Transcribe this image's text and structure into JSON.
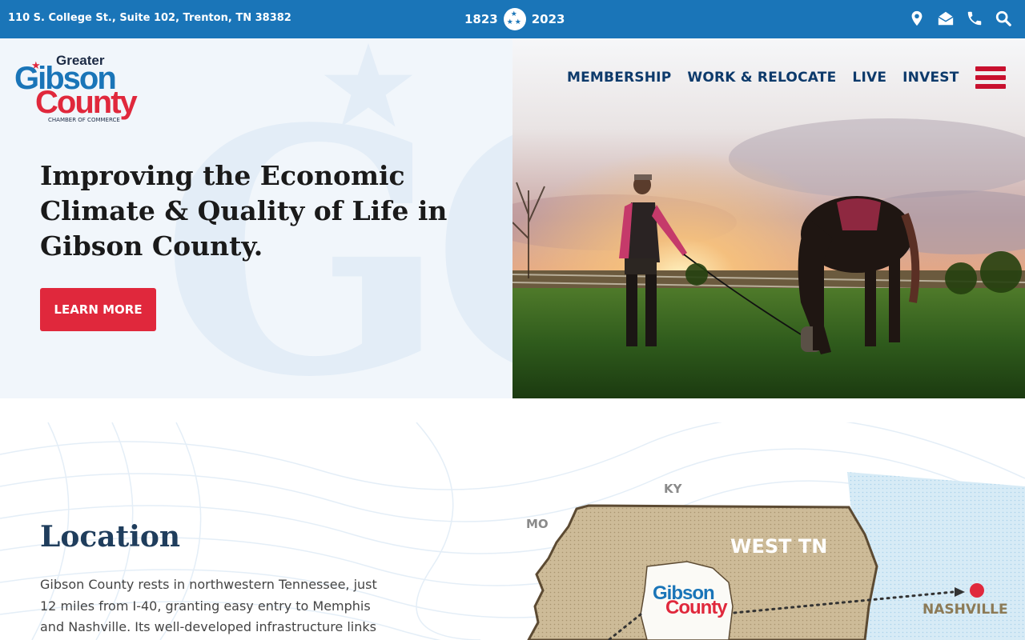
{
  "topbar": {
    "address": "110 S. College St., Suite 102, Trenton, TN 38382",
    "year_start": "1823",
    "year_end": "2023",
    "icons": [
      "location-pin-icon",
      "mail-icon",
      "phone-icon",
      "search-icon"
    ]
  },
  "logo": {
    "greater": "Greater",
    "gibson": "Gibson",
    "county": "County",
    "chamber": "CHAMBER OF COMMERCE"
  },
  "nav": {
    "items": [
      "MEMBERSHIP",
      "WORK & RELOCATE",
      "LIVE",
      "INVEST"
    ]
  },
  "hero": {
    "title": "Improving the Economic Climate & Quality of Life in Gibson County.",
    "button_label": "LEARN MORE",
    "watermark": "GC"
  },
  "location": {
    "title": "Location",
    "text": "Gibson County rests in northwestern Tennessee, just 12 miles from I-40, granting easy entry to Memphis and Nashville. Its well-developed infrastructure links residents"
  },
  "map": {
    "state_labels": [
      "KY",
      "MO"
    ],
    "region_label": "WEST TN",
    "county_label_1": "Gibson",
    "county_label_2": "County",
    "city_label": "NASHVILLE"
  },
  "colors": {
    "topbar": "#1a75b8",
    "brand_red": "#e0283c",
    "nav_text": "#0d3a6b",
    "map_land": "#cdbb98"
  }
}
